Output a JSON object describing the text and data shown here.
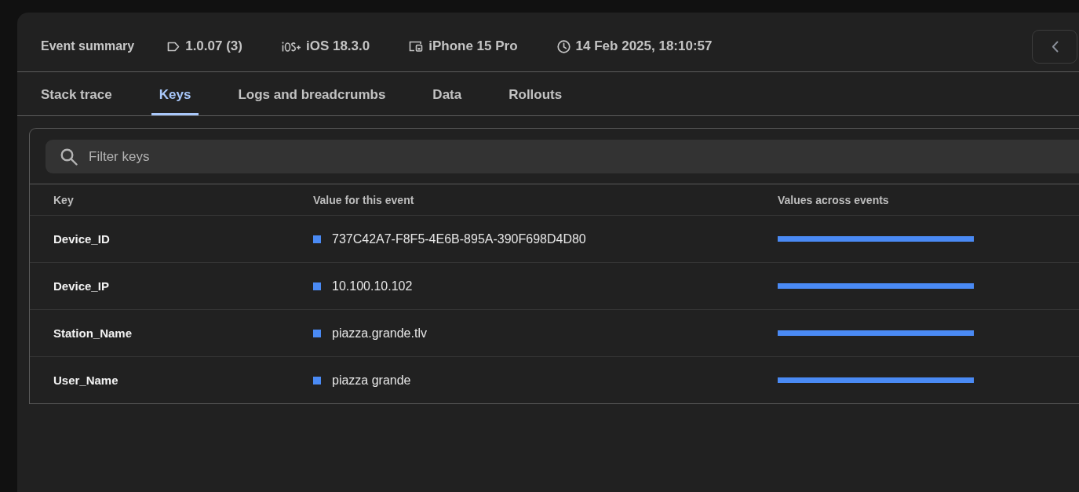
{
  "header": {
    "title": "Event summary",
    "meta": [
      {
        "kind": "version",
        "text": "1.0.07 (3)"
      },
      {
        "kind": "os",
        "text": "iOS 18.3.0"
      },
      {
        "kind": "device",
        "text": "iPhone 15 Pro"
      },
      {
        "kind": "time",
        "text": "14 Feb 2025, 18:10:57"
      }
    ]
  },
  "tabs": [
    {
      "label": "Stack trace",
      "selected": false
    },
    {
      "label": "Keys",
      "selected": true
    },
    {
      "label": "Logs and breadcrumbs",
      "selected": false
    },
    {
      "label": "Data",
      "selected": false
    },
    {
      "label": "Rollouts",
      "selected": false
    }
  ],
  "search": {
    "placeholder": "Filter keys"
  },
  "table": {
    "columns": [
      "Key",
      "Value for this event",
      "Values across events"
    ],
    "rows": [
      {
        "key": "Device_ID",
        "value": "737C42A7-F8F5-4E6B-895A-390F698D4D80"
      },
      {
        "key": "Device_IP",
        "value": "10.100.10.102"
      },
      {
        "key": "Station_Name",
        "value": "piazza.grande.tlv"
      },
      {
        "key": "User_Name",
        "value": "piazza grande"
      }
    ]
  }
}
